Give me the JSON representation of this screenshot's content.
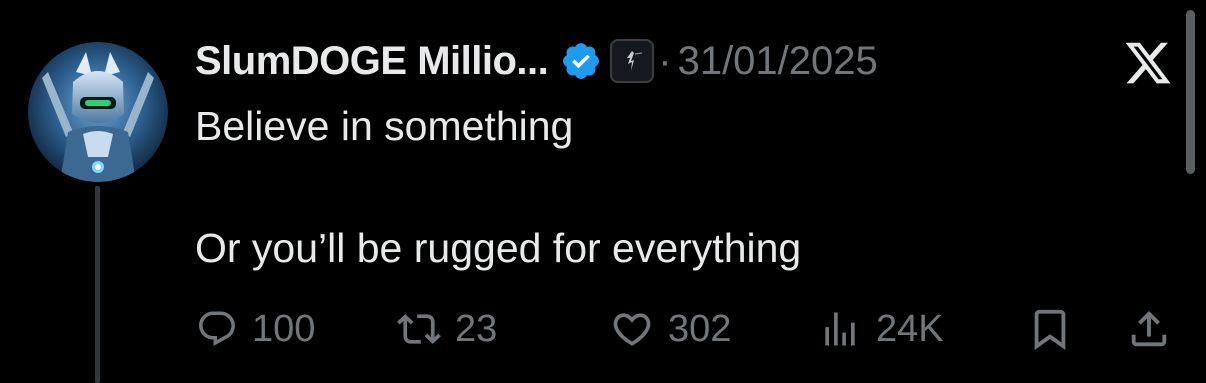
{
  "post": {
    "author_name": "SlumDOGE Millio...",
    "separator": "·",
    "date": "31/01/2025",
    "text_line1": "Believe in something",
    "text_line2": "",
    "text_line3": "Or you’ll be rugged for everything",
    "verified_badge_icon": "verified-check-icon",
    "affiliate_badge_icon": "affiliate-badge-icon"
  },
  "actions": {
    "replies": "100",
    "reposts": "23",
    "likes": "302",
    "views": "24K"
  },
  "icons": {
    "reply": "speech-bubble-icon",
    "repost": "repost-arrows-icon",
    "like": "heart-icon",
    "views": "bar-chart-icon",
    "bookmark": "bookmark-icon",
    "share": "share-upload-icon",
    "platform": "x-logo-icon"
  },
  "colors": {
    "background": "#000000",
    "primary_text": "#e7e9ea",
    "secondary_text": "#71767b",
    "verified_blue": "#1d9bf0"
  }
}
